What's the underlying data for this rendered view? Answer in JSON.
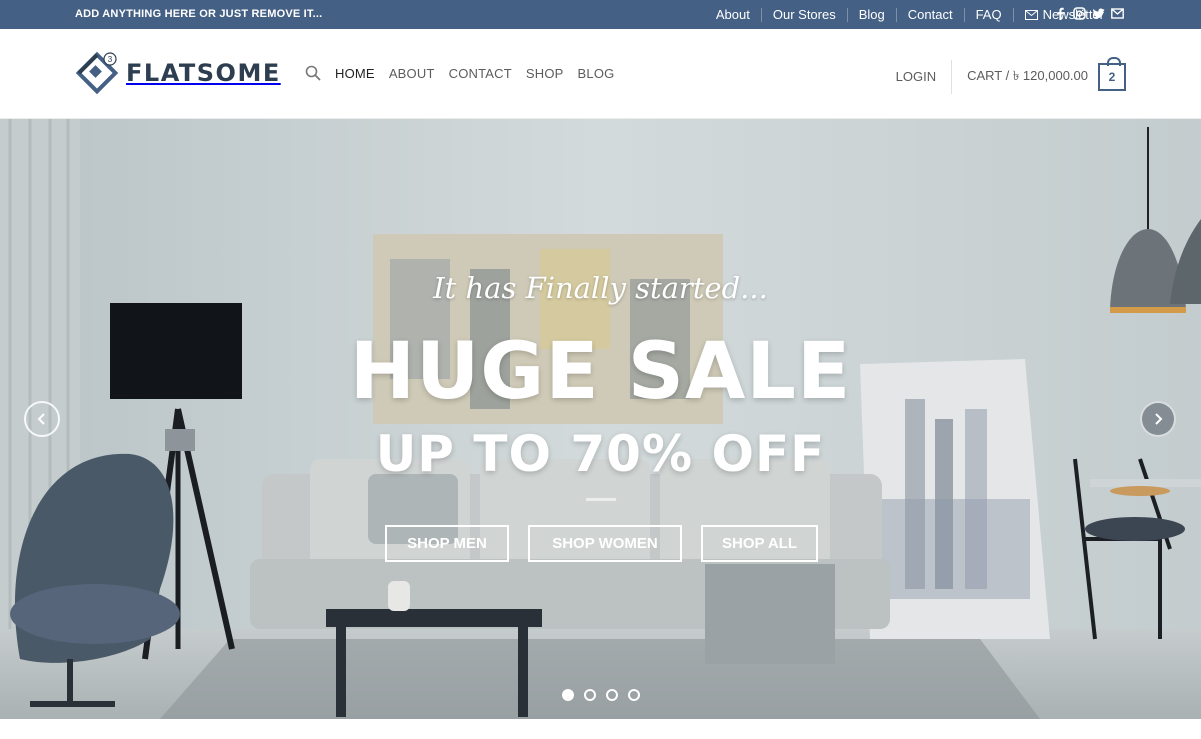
{
  "topbar": {
    "promo": "ADD ANYTHING HERE OR JUST REMOVE IT...",
    "links": [
      "About",
      "Our Stores",
      "Blog",
      "Contact",
      "FAQ"
    ],
    "newsletter": "Newsletter",
    "social_icons": [
      "facebook-icon",
      "instagram-icon",
      "twitter-icon",
      "email-icon"
    ]
  },
  "header": {
    "logo_text": "FLATSOME",
    "logo_badge": "3",
    "nav": [
      "HOME",
      "ABOUT",
      "CONTACT",
      "SHOP",
      "BLOG"
    ],
    "login": "LOGIN",
    "cart_label": "CART / ৳ 120,000.00",
    "cart_count": "2"
  },
  "hero": {
    "kicker": "It has Finally started...",
    "title": "HUGE SALE",
    "subtitle": "UP TO 70% OFF",
    "buttons": [
      "SHOP MEN",
      "SHOP WOMEN",
      "SHOP ALL"
    ],
    "slides": 4,
    "active_slide": 1
  },
  "colors": {
    "primary": "#446084",
    "text": "#5c5c5c"
  }
}
